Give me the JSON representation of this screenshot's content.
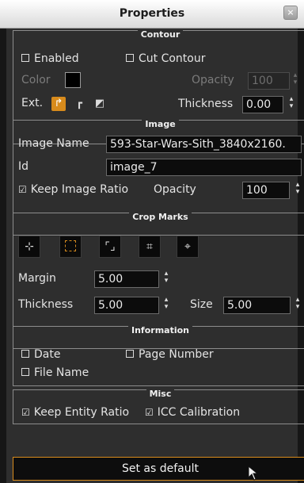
{
  "window": {
    "title": "Properties",
    "close_glyph": "×"
  },
  "contour": {
    "legend": "Contour",
    "enabled_label": "Enabled",
    "enabled_checked": false,
    "cut_contour_label": "Cut Contour",
    "cut_contour_checked": false,
    "color_label": "Color",
    "color_value": "#000000",
    "opacity_label": "Opacity",
    "opacity_value": "100",
    "ext_label": "Ext.",
    "ext_icons": [
      "extend-corner-icon",
      "corner-in-icon",
      "corner-out-icon"
    ],
    "thickness_label": "Thickness",
    "thickness_value": "0.00"
  },
  "image": {
    "legend": "Image",
    "name_label": "Image Name",
    "name_value": "593-Star-Wars-Sith_3840x2160.",
    "id_label": "Id",
    "id_value": "image_7",
    "keep_ratio_label": "Keep Image Ratio",
    "keep_ratio_checked": true,
    "opacity_label": "Opacity",
    "opacity_value": "100"
  },
  "crop_marks": {
    "legend": "Crop Marks",
    "buttons": [
      "crop-marks-inner-icon",
      "frame-outline-icon",
      "corner-brackets-icon",
      "corner-cuts-icon",
      "crosshair-icon"
    ],
    "margin_label": "Margin",
    "margin_value": "5.00",
    "thickness_label": "Thickness",
    "thickness_value": "5.00",
    "size_label": "Size",
    "size_value": "5.00"
  },
  "information": {
    "legend": "Information",
    "date_label": "Date",
    "date_checked": false,
    "page_number_label": "Page Number",
    "page_number_checked": false,
    "file_name_label": "File Name",
    "file_name_checked": false
  },
  "misc": {
    "legend": "Misc",
    "keep_entity_ratio_label": "Keep Entity Ratio",
    "keep_entity_ratio_checked": true,
    "icc_label": "ICC Calibration",
    "icc_checked": true
  },
  "footer": {
    "set_default_label": "Set as default"
  },
  "colors": {
    "accent": "#d88b1c",
    "panel": "#2e2e2e",
    "field": "#0c0c0c"
  }
}
